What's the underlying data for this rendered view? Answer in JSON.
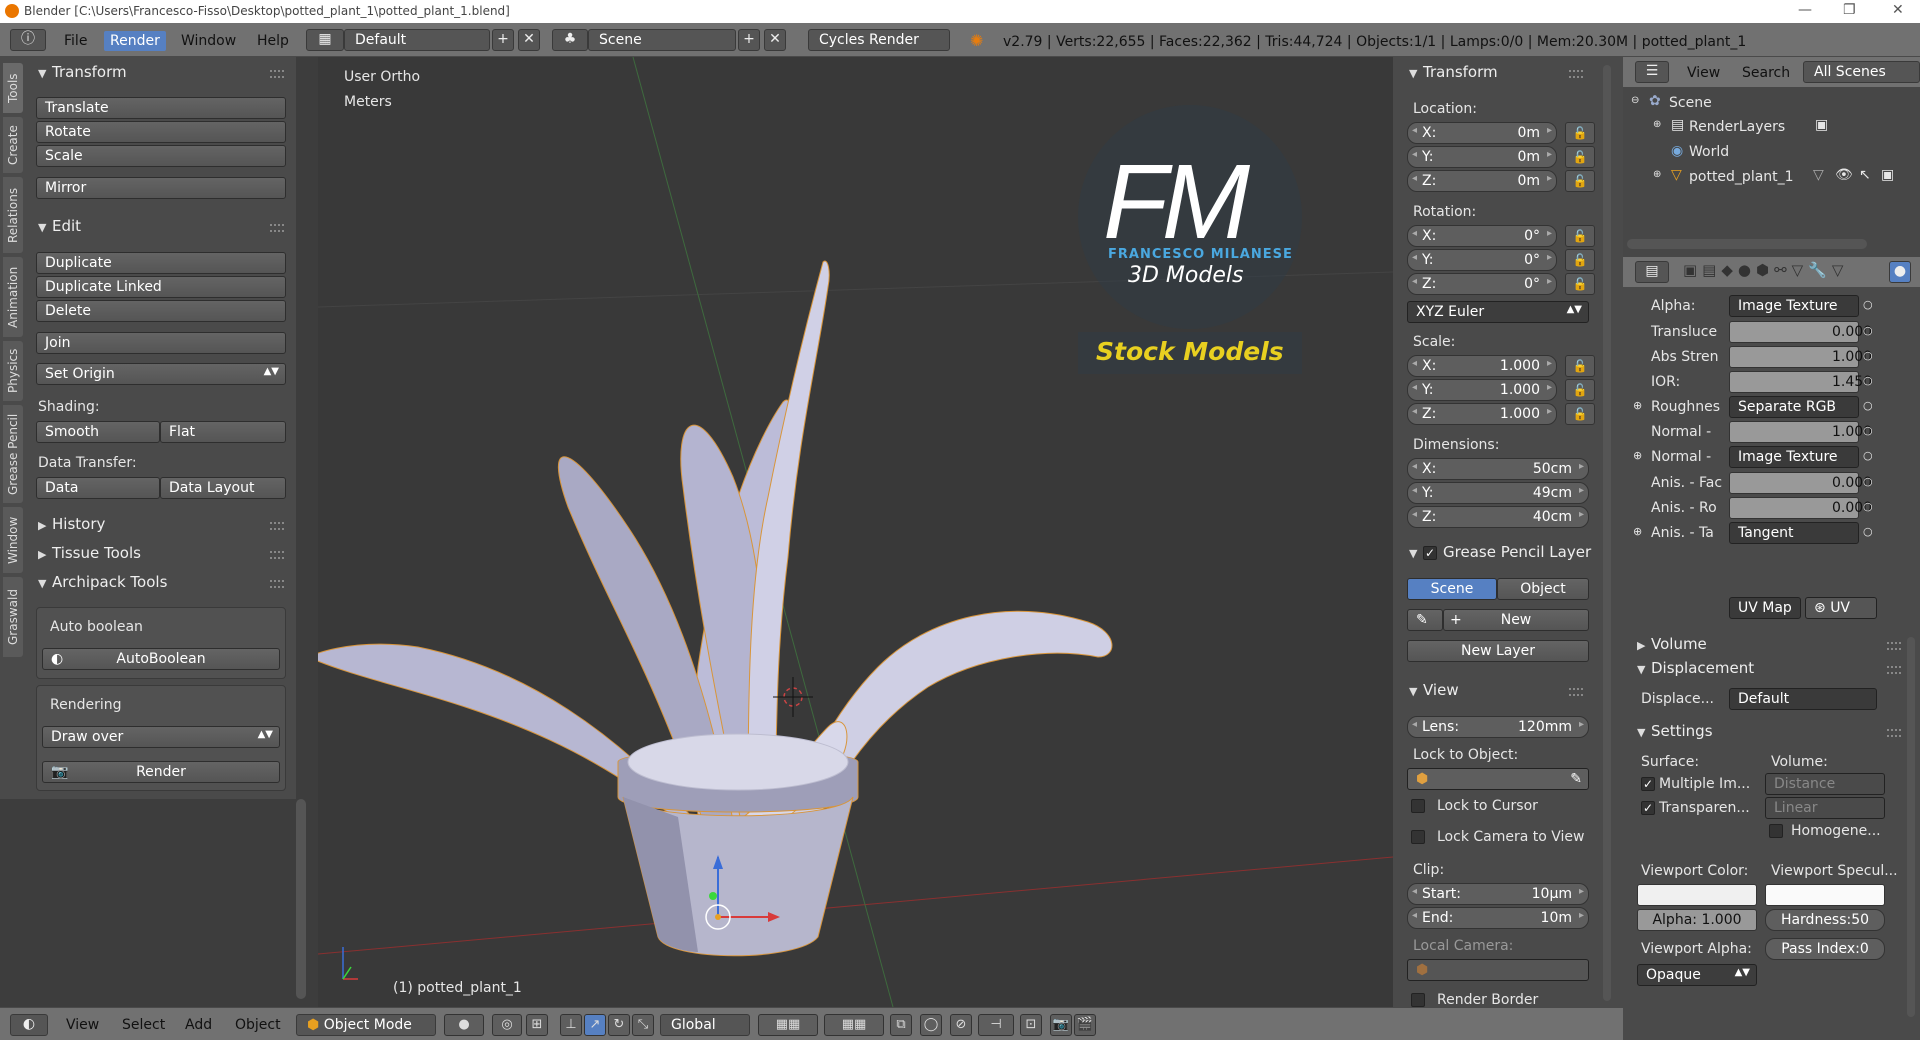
{
  "title_bar": {
    "text": "Blender [C:\\Users\\Francesco-Fisso\\Desktop\\potted_plant_1\\potted_plant_1.blend]"
  },
  "header": {
    "menus": [
      "File",
      "Render",
      "Window",
      "Help"
    ],
    "screen_layout": "Default",
    "scene": "Scene",
    "render_engine": "Cycles Render",
    "stats": "v2.79 | Verts:22,655 | Faces:22,362 | Tris:44,724 | Objects:1/1 | Lamps:0/0 | Mem:20.30M | potted_plant_1"
  },
  "left_tabs": [
    "Tools",
    "Create",
    "Relations",
    "Animation",
    "Physics",
    "Grease Pencil",
    "Window",
    "Graswald"
  ],
  "tools": {
    "transform": {
      "title": "Transform",
      "buttons": [
        "Translate",
        "Rotate",
        "Scale",
        "Mirror"
      ]
    },
    "edit": {
      "title": "Edit",
      "buttons": [
        "Duplicate",
        "Duplicate Linked",
        "Delete",
        "Join"
      ],
      "set_origin": "Set Origin",
      "shading_label": "Shading:",
      "shading": [
        "Smooth",
        "Flat"
      ],
      "data_transfer_label": "Data Transfer:",
      "data_transfer": [
        "Data",
        "Data Layout"
      ]
    },
    "history": "History",
    "tissue": "Tissue Tools",
    "archipack": {
      "title": "Archipack Tools",
      "auto_boolean_label": "Auto boolean",
      "auto_boolean_btn": "AutoBoolean",
      "rendering_label": "Rendering",
      "draw_mode": "Draw over",
      "render_btn": "Render"
    }
  },
  "viewport": {
    "view_name": "User Ortho",
    "units": "Meters",
    "object_label": "(1) potted_plant_1",
    "watermark": {
      "letters": "FM",
      "name": "FRANCESCO MILANESE",
      "sub": "3D Models",
      "tag": "Stock Models"
    }
  },
  "npanel": {
    "transform_title": "Transform",
    "location_label": "Location:",
    "location": [
      {
        "k": "X:",
        "v": "0m"
      },
      {
        "k": "Y:",
        "v": "0m"
      },
      {
        "k": "Z:",
        "v": "0m"
      }
    ],
    "rotation_label": "Rotation:",
    "rotation": [
      {
        "k": "X:",
        "v": "0°"
      },
      {
        "k": "Y:",
        "v": "0°"
      },
      {
        "k": "Z:",
        "v": "0°"
      }
    ],
    "rotation_mode": "XYZ Euler",
    "scale_label": "Scale:",
    "scale": [
      {
        "k": "X:",
        "v": "1.000"
      },
      {
        "k": "Y:",
        "v": "1.000"
      },
      {
        "k": "Z:",
        "v": "1.000"
      }
    ],
    "dimensions_label": "Dimensions:",
    "dimensions": [
      {
        "k": "X:",
        "v": "50cm"
      },
      {
        "k": "Y:",
        "v": "49cm"
      },
      {
        "k": "Z:",
        "v": "40cm"
      }
    ],
    "grease_title": "Grease Pencil Layer",
    "grease_tabs": [
      "Scene",
      "Object"
    ],
    "new_btn": "New",
    "new_layer_btn": "New Layer",
    "view_title": "View",
    "lens": {
      "k": "Lens:",
      "v": "120mm"
    },
    "lock_to_object": "Lock to Object:",
    "lock_cursor": "Lock to Cursor",
    "lock_camera": "Lock Camera to View",
    "clip_label": "Clip:",
    "clip_start": {
      "k": "Start:",
      "v": "10μm"
    },
    "clip_end": {
      "k": "End:",
      "v": "10m"
    },
    "local_camera": "Local Camera:",
    "render_border": "Render Border"
  },
  "outliner": {
    "menus": [
      "View",
      "Search"
    ],
    "filter": "All Scenes",
    "items": [
      "Scene",
      "RenderLayers",
      "World",
      "potted_plant_1"
    ]
  },
  "properties": {
    "rows": [
      {
        "label": "Alpha:",
        "kind": "select",
        "value": "Image Texture"
      },
      {
        "label": "Transluce",
        "kind": "slider",
        "value": "0.000"
      },
      {
        "label": "Abs Stren",
        "kind": "slider",
        "value": "1.000"
      },
      {
        "label": "IOR:",
        "kind": "slider",
        "value": "1.450"
      },
      {
        "label": "Roughnes",
        "kind": "select",
        "value": "Separate RGB"
      },
      {
        "label": "Normal -",
        "kind": "slider",
        "value": "1.000"
      },
      {
        "label": "Normal -",
        "kind": "select",
        "value": "Image Texture"
      },
      {
        "label": "Anis. - Fac",
        "kind": "slider",
        "value": "0.000"
      },
      {
        "label": "Anis. - Ro",
        "kind": "slider",
        "value": "0.000"
      },
      {
        "label": "Anis. - Ta",
        "kind": "select",
        "value": "Tangent"
      }
    ],
    "uv_map": "UV Map",
    "uv": "UV",
    "volume": "Volume",
    "displacement": "Displacement",
    "displace_label": "Displace...",
    "displace_value": "Default",
    "settings": "Settings",
    "surface": "Surface:",
    "volume_label": "Volume:",
    "multiple_importance": "Multiple Im...",
    "transparent": "Transparen...",
    "distance": "Distance",
    "linear": "Linear",
    "homogeneous": "Homogene...",
    "viewport_color": "Viewport Color:",
    "viewport_specular": "Viewport Specul...",
    "alpha_val": "Alpha: 1.000",
    "hardness_val": "Hardness:50",
    "viewport_alpha": "Viewport Alpha:",
    "pass_index": "Pass Index:0",
    "opaque": "Opaque"
  },
  "bottom": {
    "menus": [
      "View",
      "Select",
      "Add",
      "Object"
    ],
    "mode": "Object Mode",
    "orientation": "Global"
  }
}
